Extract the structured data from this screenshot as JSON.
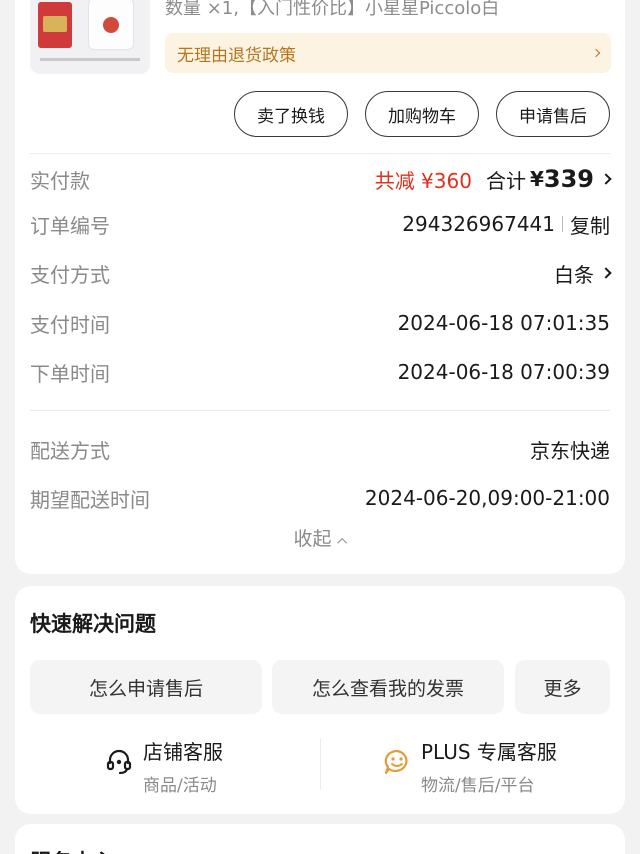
{
  "product": {
    "title": "数量 ×1,【入门性价比】小星星Piccolo白",
    "policy_label": "无理由退货政策"
  },
  "actions": {
    "sell_label": "卖了换钱",
    "cart_label": "加购物车",
    "after_sale_label": "申请售后"
  },
  "order": {
    "paid": {
      "label": "实付款",
      "discount": "共减 ¥360",
      "total_label": "合计",
      "currency": "¥",
      "amount": "339"
    },
    "order_number": {
      "label": "订单编号",
      "value": "294326967441",
      "copy_label": "复制"
    },
    "pay_method": {
      "label": "支付方式",
      "value": "白条"
    },
    "pay_time": {
      "label": "支付时间",
      "value": "2024-06-18 07:01:35"
    },
    "order_time": {
      "label": "下单时间",
      "value": "2024-06-18 07:00:39"
    },
    "delivery_method": {
      "label": "配送方式",
      "value": "京东快递"
    },
    "expected_delivery": {
      "label": "期望配送时间",
      "value": "2024-06-20,09:00-21:00"
    },
    "collapse_label": "收起"
  },
  "quick_help": {
    "title": "快速解决问题",
    "chips": [
      "怎么申请售后",
      "怎么查看我的发票",
      "更多"
    ],
    "store_service": {
      "name": "店铺客服",
      "sub": "商品/活动"
    },
    "plus_service": {
      "name": "PLUS 专属客服",
      "sub": "物流/售后/平台"
    }
  },
  "service_card": {
    "title": "服务中心"
  },
  "colors": {
    "discount_red": "#e0301e",
    "policy_bg": "#fdf3e3",
    "policy_text": "#b5761d",
    "plus_icon": "#e79a3a"
  },
  "icons": [
    "product-thumbnail",
    "chevron-right-icon",
    "chevron-up-icon",
    "headset-icon",
    "smile-chat-icon"
  ]
}
